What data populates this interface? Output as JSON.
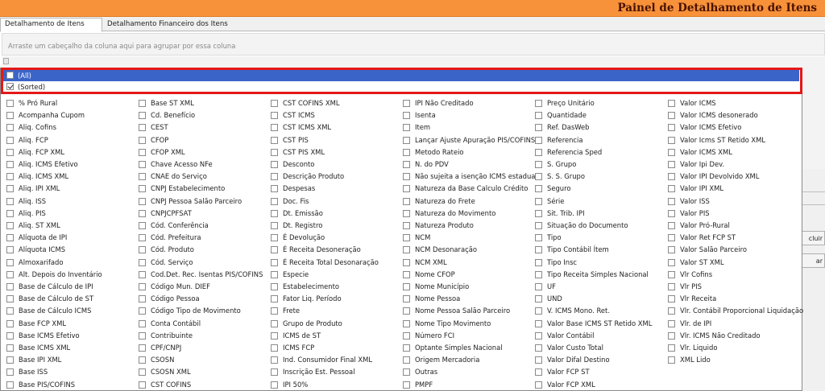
{
  "window": {
    "title": "Painel de Detalhamento de Itens"
  },
  "tabs": [
    {
      "label": "Detalhamento de Itens"
    },
    {
      "label": "Detalhamento Financeiro dos Itens"
    }
  ],
  "group_hint": "Arraste um cabeçalho da coluna aqui para agrupar por essa coluna",
  "side_buttons": [
    "cluir",
    "ar"
  ],
  "popup": {
    "all_label": "(All)",
    "sorted_label": "(Sorted)",
    "sorted_checked": true,
    "columns": [
      [
        "% Pró Rural",
        "Acompanha Cupom",
        "Aliq. Cofins",
        "Aliq. FCP",
        "Aliq. FCP XML",
        "Aliq. ICMS Efetivo",
        "Aliq. ICMS XML",
        "Aliq. IPI XML",
        "Aliq. ISS",
        "Aliq. PIS",
        "Aliq. ST XML",
        "Alíquota de IPI",
        "Alíquota ICMS",
        "Almoxarifado",
        "Alt. Depois do Inventário",
        "Base de Cálculo de IPI",
        "Base de Cálculo de ST",
        "Base de Cálculo ICMS",
        "Base FCP XML",
        "Base ICMS Efetivo",
        "Base ICMS XML",
        "Base IPI XML",
        "Base ISS",
        "Base PIS/COFINS"
      ],
      [
        "Base ST XML",
        "Cd. Benefício",
        "CEST",
        "CFOP",
        "CFOP XML",
        "Chave Acesso NFe",
        "CNAE do Serviço",
        "CNPJ Estabelecimento",
        "CNPJ Pessoa Salão Parceiro",
        "CNPJCPFSAT",
        "Cód. Conferência",
        "Cód. Prefeitura",
        "Cód. Produto",
        "Cód. Serviço",
        "Cod.Det. Rec. Isentas PIS/COFINS",
        "Código Mun. DIEF",
        "Código Pessoa",
        "Código Tipo de Movimento",
        "Conta Contábil",
        "Contribuinte",
        "CPF/CNPJ",
        "CSOSN",
        "CSOSN XML",
        "CST COFINS"
      ],
      [
        "CST COFINS XML",
        "CST ICMS",
        "CST ICMS XML",
        "CST PIS",
        "CST PIS XML",
        "Desconto",
        "Descrição Produto",
        "Despesas",
        "Doc. Fis",
        "Dt. Emissão",
        "Dt. Registro",
        "É Devolução",
        "É Receita Desoneração",
        "É Receita Total Desonaração",
        "Especie",
        "Estabelecimento",
        "Fator Liq. Período",
        "Frete",
        "Grupo de Produto",
        "ICMS de ST",
        "ICMS FCP",
        "Ind. Consumidor Final XML",
        "Inscrição Est. Pessoal",
        "IPI 50%"
      ],
      [
        "IPI Não Creditado",
        "Isenta",
        "Item",
        "Lançar Ajuste Apuração PIS/COFINS",
        "Metodo Rateio",
        "N. do PDV",
        "Não sujeita a isenção ICMS estadual",
        "Natureza da Base Calculo Crédito",
        "Natureza do Frete",
        "Natureza do Movimento",
        "Natureza Produto",
        "NCM",
        "NCM Desonaração",
        "NCM XML",
        "Nome CFOP",
        "Nome Município",
        "Nome Pessoa",
        "Nome Pessoa Salão Parceiro",
        "Nome Tipo Movimento",
        "Número FCI",
        "Optante Simples Nacional",
        "Origem Mercadoria",
        "Outras",
        "PMPF"
      ],
      [
        "Preço Unitário",
        "Quantidade",
        "Ref. DasWeb",
        "Referencia",
        "Referencia Sped",
        "S. Grupo",
        "S. S. Grupo",
        "Seguro",
        "Série",
        "Sit. Trib. IPI",
        "Situação do Documento",
        "Tipo",
        "Tipo Contábil Ítem",
        "Tipo Insc",
        "Tipo Receita Simples Nacional",
        "UF",
        "UND",
        "V. ICMS Mono. Ret.",
        "Valor Base ICMS ST Retido XML",
        "Valor Contábil",
        "Valor Custo Total",
        "Valor Difal Destino",
        "Valor FCP ST",
        "Valor FCP XML"
      ],
      [
        "Valor ICMS",
        "Valor ICMS desonerado",
        "Valor ICMS Efetivo",
        "Valor Icms ST Retido XML",
        "Valor ICMS XML",
        "Valor Ipi Dev.",
        "Valor IPI Devolvido XML",
        "Valor IPI XML",
        "Valor ISS",
        "Valor PIS",
        "Valor Pró-Rural",
        "Valor Ret FCP ST",
        "Valor Salão Parceiro",
        "Valor ST XML",
        "Vlr Cofins",
        "Vlr PIS",
        "Vlr Receita",
        "Vlr. Contábil Proporcional Liquidação",
        "Vlr. de IPI",
        "Vlr. ICMS Não Creditado",
        "Vlr. Liquido",
        "XML Lido"
      ]
    ]
  }
}
